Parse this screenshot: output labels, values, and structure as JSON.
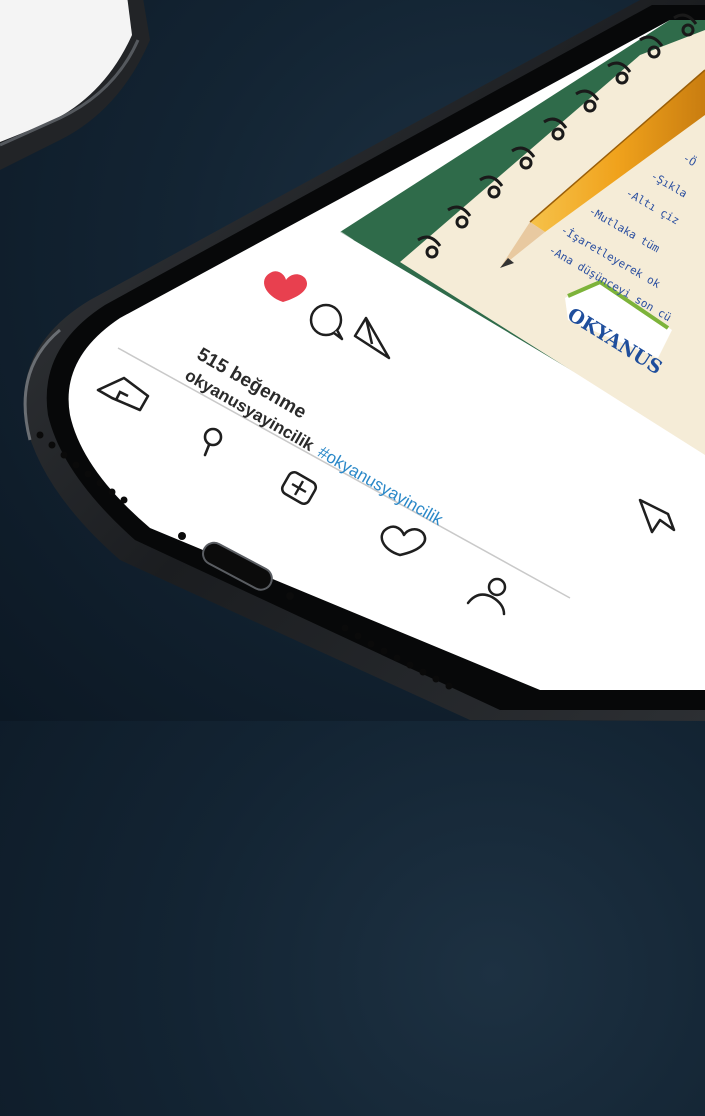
{
  "post": {
    "likes": "515 beğenme",
    "username": "okyanusyayincilik",
    "hashtag": "#okyanusyayincilik",
    "brand_logo": "OKYANUS"
  },
  "notebook": {
    "lines": [
      "-Ö",
      "-Şıkla",
      "-Altı çiz",
      "-Mutlaka tüm",
      "-İşaretleyerek ok",
      "-Ana düşünceyi son cü"
    ]
  },
  "icons": {
    "like": "heart-filled-icon",
    "comment": "comment-bubble-icon",
    "share": "paper-plane-icon",
    "save": "bookmark-icon",
    "home": "home-icon",
    "search": "search-icon",
    "add": "add-post-icon",
    "activity": "heart-outline-icon",
    "profile": "profile-icon"
  },
  "colors": {
    "like": "#e8404f",
    "hashtag": "#2a88c8",
    "notebook_bg": "#2f6b4a",
    "pencil": "#f0a21c"
  }
}
